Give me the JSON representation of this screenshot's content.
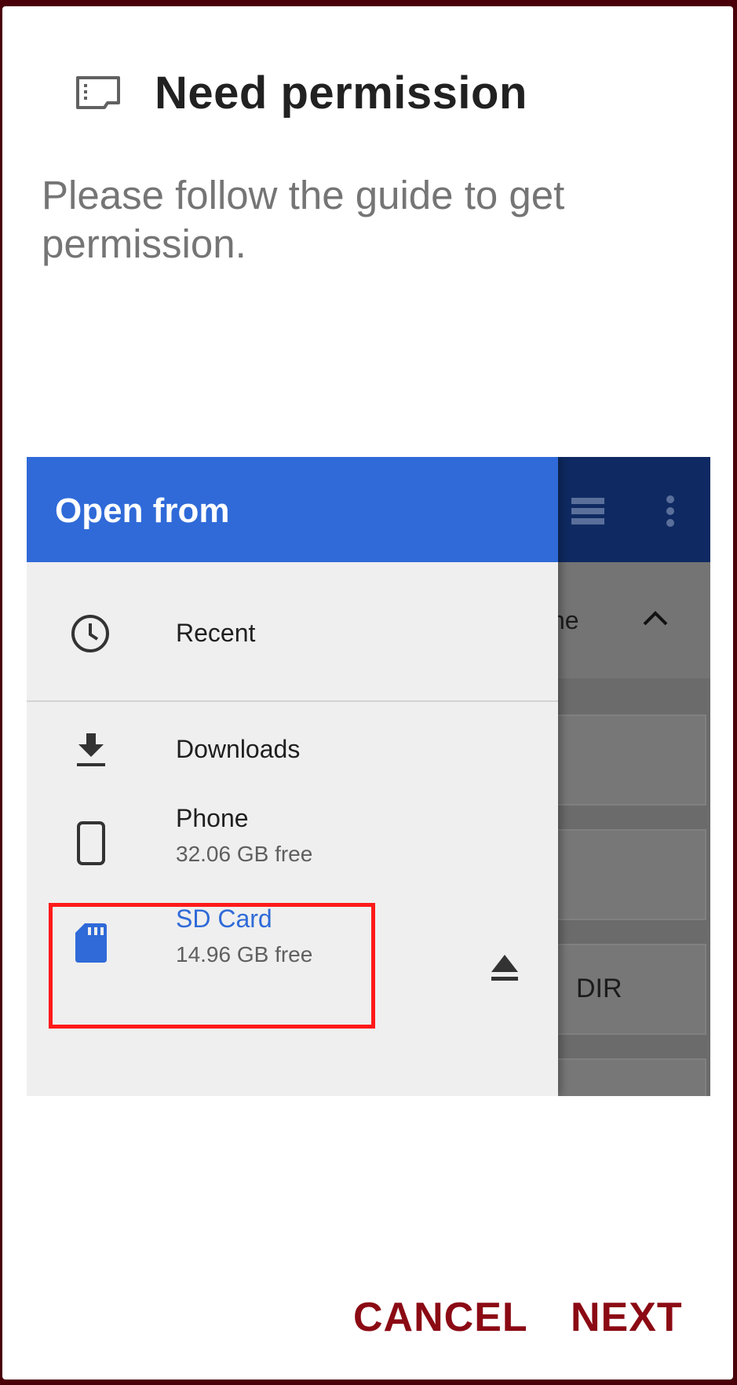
{
  "dialog": {
    "title": "Need permission",
    "title_icon": "sd-card-outline-icon",
    "message": "Please follow the guide to get permission."
  },
  "guide": {
    "drawer_title": "Open from",
    "items": [
      {
        "icon": "clock-icon",
        "label": "Recent"
      },
      {
        "icon": "download-icon",
        "label": "Downloads"
      },
      {
        "icon": "phone-icon",
        "label": "Phone",
        "sub": "32.06 GB free"
      },
      {
        "icon": "sd-card-icon",
        "label": "SD Card",
        "sub": "14.96 GB free",
        "highlighted": true
      }
    ],
    "background": {
      "sort_label_fragment": "ne",
      "dir_fragment": "DIR"
    }
  },
  "buttons": {
    "cancel": "CANCEL",
    "next": "NEXT"
  },
  "colors": {
    "accent": "#8b0a14",
    "drawer_header": "#2f6ad8",
    "highlight": "#ff1a1a"
  }
}
